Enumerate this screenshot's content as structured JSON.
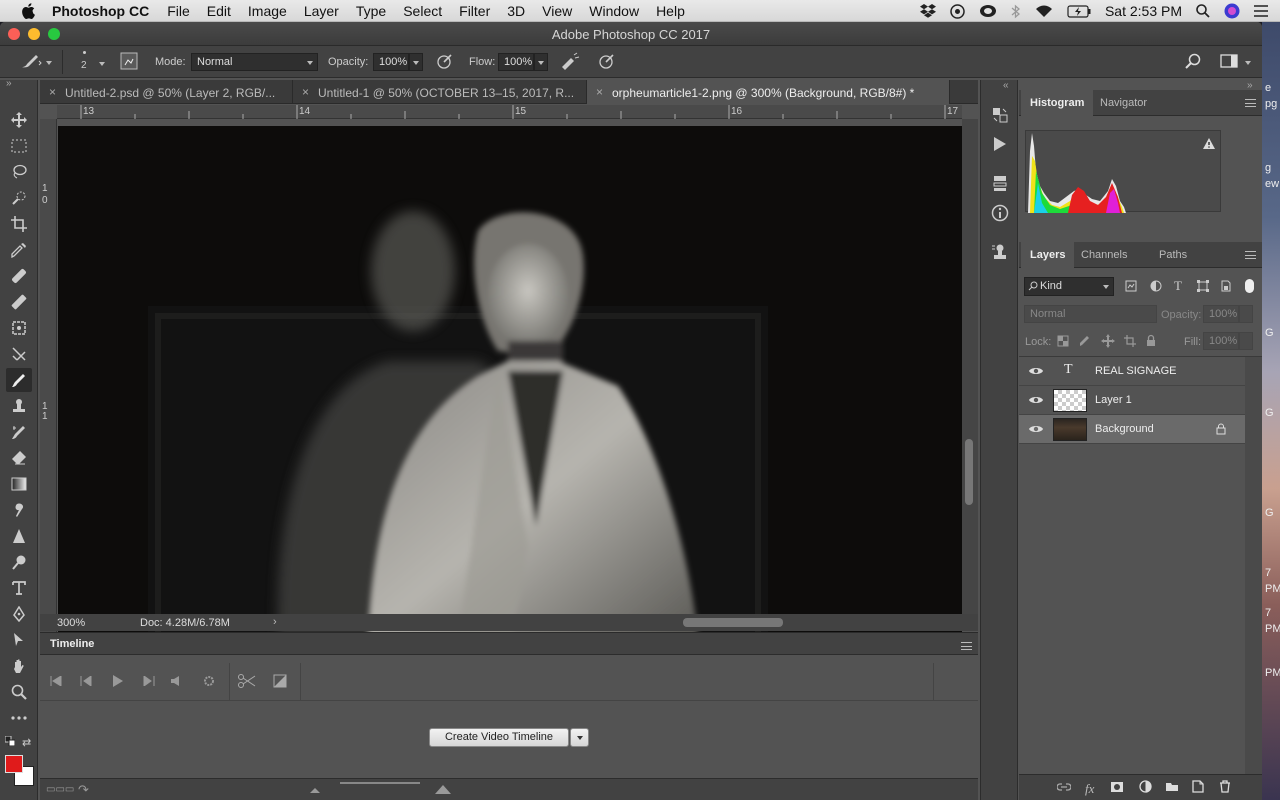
{
  "menubar": {
    "app_name": "Photoshop CC",
    "items": [
      "File",
      "Edit",
      "Image",
      "Layer",
      "Type",
      "Select",
      "Filter",
      "3D",
      "View",
      "Window",
      "Help"
    ],
    "clock": "Sat 2:53 PM"
  },
  "window": {
    "title": "Adobe Photoshop CC 2017"
  },
  "options": {
    "brush_size": "2",
    "mode_label": "Mode:",
    "mode_value": "Normal",
    "opacity_label": "Opacity:",
    "opacity_value": "100%",
    "flow_label": "Flow:",
    "flow_value": "100%"
  },
  "tabs": [
    {
      "label": "Untitled-2.psd @ 50% (Layer 2, RGB/..."
    },
    {
      "label": "Untitled-1 @ 50% (OCTOBER 13–15, 2017, R..."
    },
    {
      "label": "orpheumarticle1-2.png @ 300% (Background, RGB/8#) *"
    }
  ],
  "ruler": {
    "h_ticks": [
      "13",
      "14",
      "15",
      "16",
      "17"
    ],
    "v_ticks": [
      "1",
      "0",
      "1",
      "1"
    ]
  },
  "status": {
    "zoom": "300%",
    "doc": "Doc: 4.28M/6.78M"
  },
  "timeline": {
    "title": "Timeline",
    "create_button": "Create Video Timeline"
  },
  "histogram_panel": {
    "tabs": [
      "Histogram",
      "Navigator"
    ]
  },
  "layers_panel": {
    "tabs": [
      "Layers",
      "Channels",
      "Paths"
    ],
    "filter_kind": "Kind",
    "blend_mode": "Normal",
    "opacity_label": "Opacity:",
    "opacity_value": "100%",
    "lock_label": "Lock:",
    "fill_label": "Fill:",
    "fill_value": "100%",
    "layers": [
      {
        "name": "REAL SIGNAGE",
        "type": "text"
      },
      {
        "name": "Layer 1",
        "type": "transparent"
      },
      {
        "name": "Background",
        "type": "image",
        "locked": true,
        "selected": true
      }
    ]
  },
  "colors": {
    "foreground": "#e01b1b",
    "background": "#ffffff",
    "accent": "#535353"
  }
}
